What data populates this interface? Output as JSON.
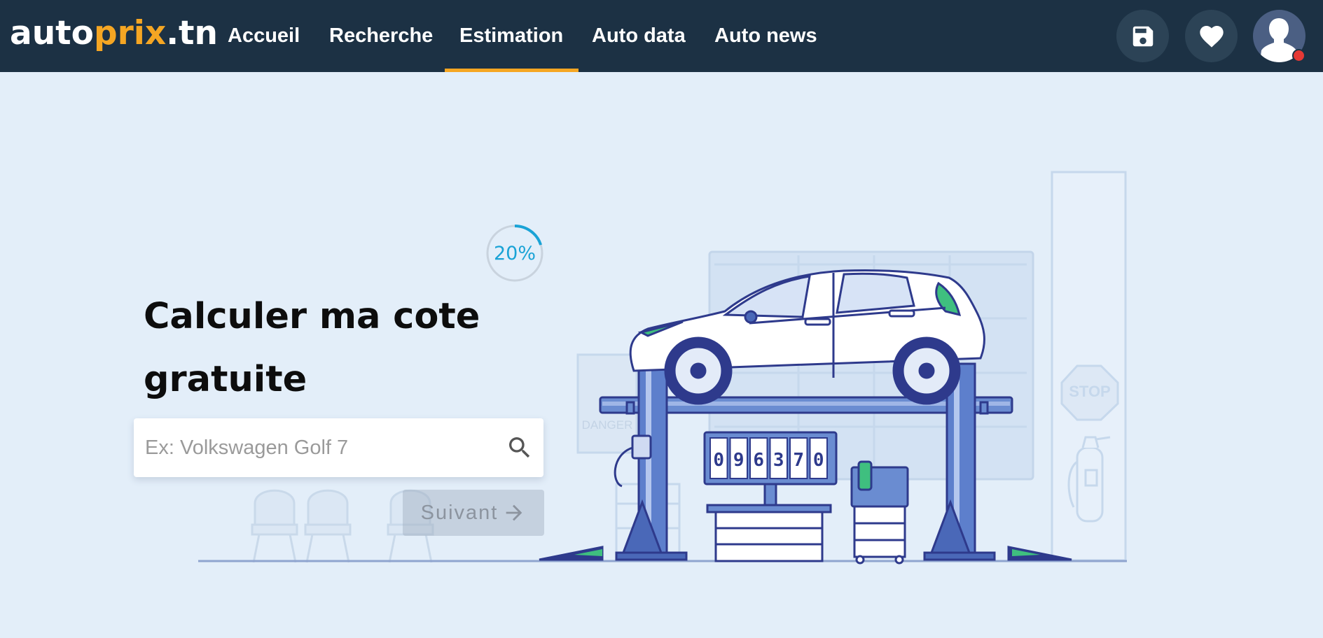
{
  "header": {
    "logo": {
      "part1": "auto",
      "part2": "prix",
      "part3": ".tn"
    },
    "nav": [
      {
        "label": "Accueil",
        "active": false
      },
      {
        "label": "Recherche",
        "active": false
      },
      {
        "label": "Estimation",
        "active": true
      },
      {
        "label": "Auto data",
        "active": false
      },
      {
        "label": "Auto news",
        "active": false
      }
    ],
    "icons": [
      "save-icon",
      "heart-icon",
      "user-avatar-icon"
    ]
  },
  "main": {
    "progress": {
      "label": "20%",
      "value": 0.2
    },
    "title": "Calculer ma cote gratuite",
    "search": {
      "placeholder": "Ex: Volkswagen Golf 7",
      "value": ""
    },
    "next_button": {
      "label": "Suivant",
      "enabled": false
    }
  },
  "illustration": {
    "odometer": [
      "0",
      "9",
      "6",
      "3",
      "7",
      "0"
    ],
    "stop_sign": "STOP",
    "danger_sign": "DANGER"
  },
  "colors": {
    "header_bg": "#1c3144",
    "accent": "#f5a623",
    "page_bg": "#e3eef9",
    "progress": "#1aa3d6",
    "line_art": "#2e3a8c"
  }
}
